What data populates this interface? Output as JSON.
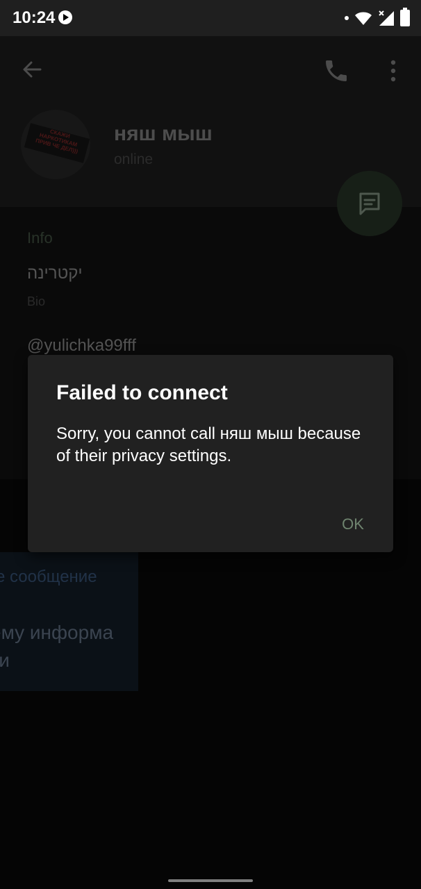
{
  "status_bar": {
    "time": "10:24",
    "icons": [
      "play-icon",
      "dot-icon",
      "wifi-icon",
      "signal-icon",
      "battery-icon"
    ]
  },
  "toolbar": {
    "icons": [
      "back-arrow-icon",
      "phone-icon",
      "more-vert-icon"
    ]
  },
  "profile": {
    "name": "няш мыш",
    "status": "online",
    "avatar_text": "СКАЖИ НАРКОТИКАМ ПРИВ ЧЕ ДЕЛ)))",
    "fab_icon": "message-icon"
  },
  "info": {
    "header": "Info",
    "bio": "יקטרינה",
    "bio_label": "Bio",
    "username": "@yulichka99fff"
  },
  "background_fragment": {
    "line1": "е сообщение",
    "line2": "ему информа",
    "line3": "ки"
  },
  "dialog": {
    "title": "Failed to connect",
    "body": "Sorry, you cannot call няш мыш because of their privacy settings.",
    "ok_label": "OK"
  },
  "colors": {
    "dialog_bg": "#212121",
    "accent_green": "#6f846f",
    "scrim": "rgba(0,0,0,0.45)"
  }
}
